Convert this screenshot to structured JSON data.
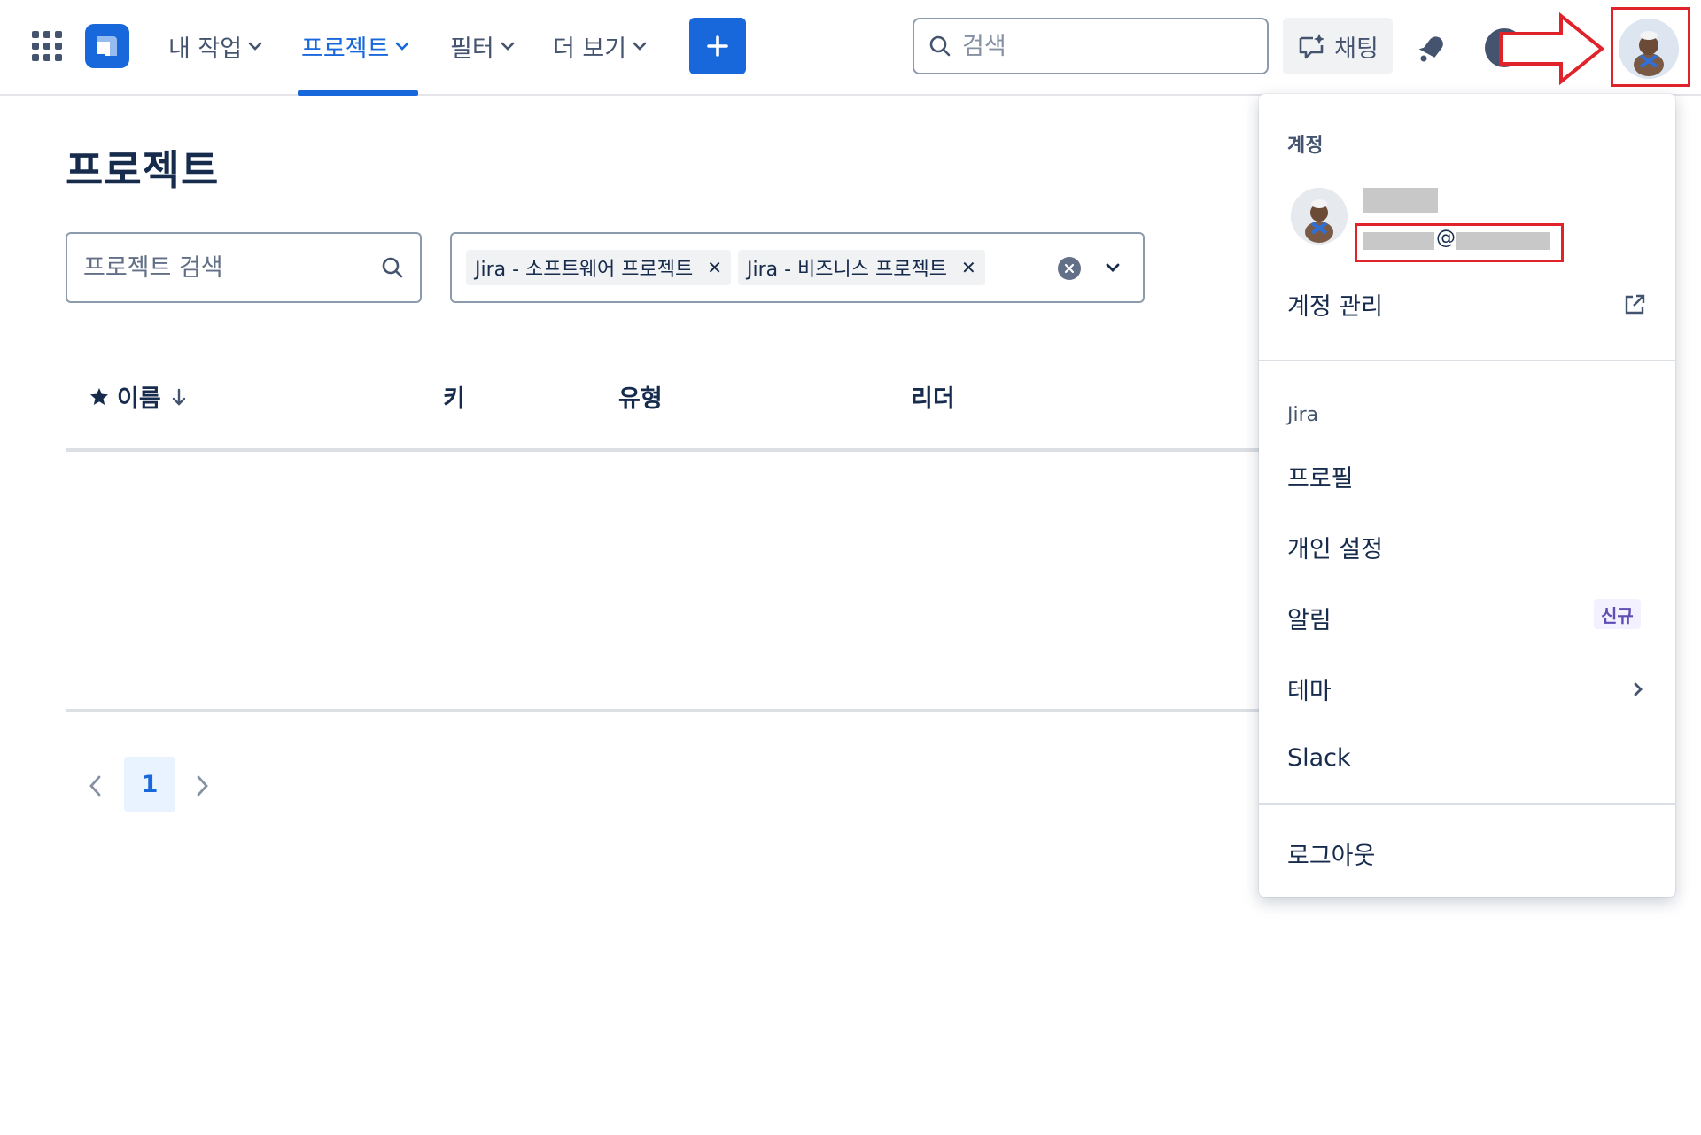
{
  "nav": {
    "my_work": "내 작업",
    "projects": "프로젝트",
    "filters": "필터",
    "more": "더 보기"
  },
  "search": {
    "placeholder": "검색"
  },
  "chat_label": "채팅",
  "page": {
    "title": "프로젝트",
    "search_placeholder": "프로젝트 검색",
    "filter_chips": [
      "Jira - 소프트웨어 프로젝트",
      "Jira - 비즈니스 프로젝트"
    ]
  },
  "table": {
    "columns": {
      "name": "이름",
      "key": "키",
      "type": "유형",
      "lead": "리더"
    }
  },
  "pagination": {
    "current_page": "1"
  },
  "account_menu": {
    "section_account": "계정",
    "email_at": "@",
    "manage_account": "계정 관리",
    "section_jira": "Jira",
    "profile": "프로필",
    "personal_settings": "개인 설정",
    "notifications": "알림",
    "new_badge": "신규",
    "theme": "테마",
    "slack": "Slack",
    "logout": "로그아웃"
  },
  "colors": {
    "brand_blue": "#1868db",
    "annotation_red": "#e0232b",
    "text_dark": "#172b4d"
  }
}
